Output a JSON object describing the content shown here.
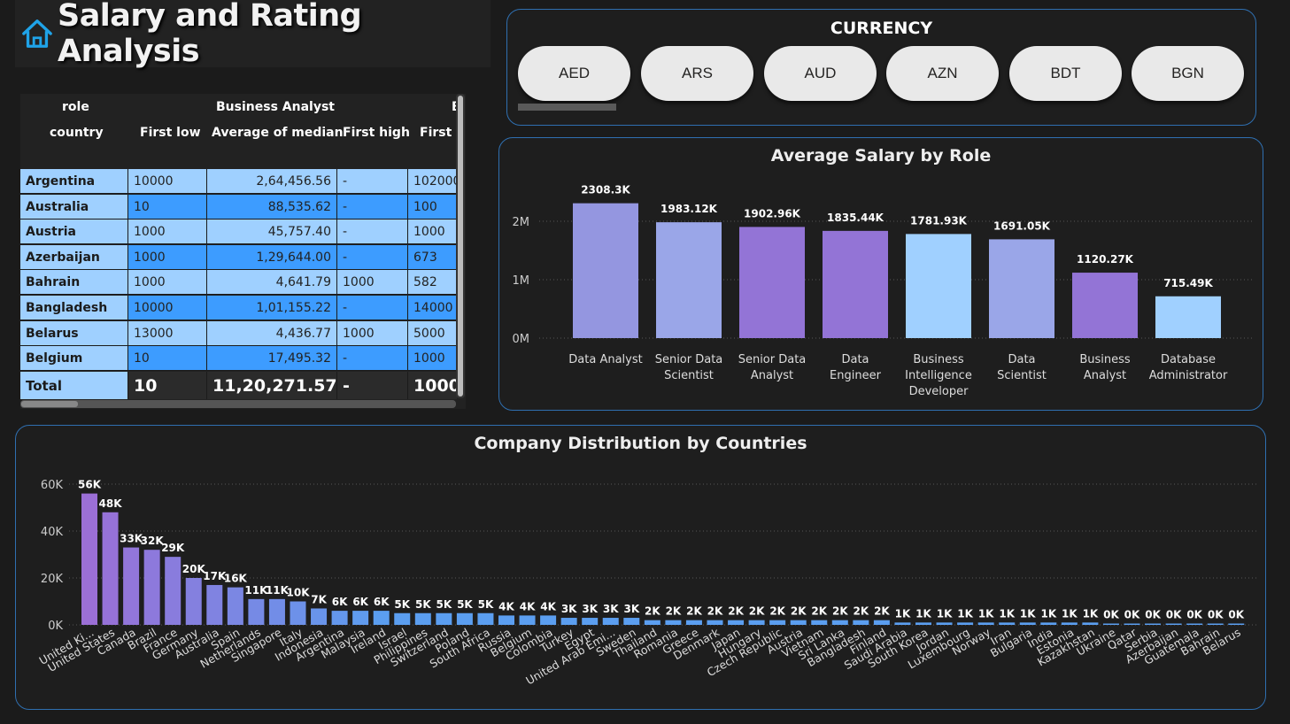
{
  "title": "Salary and Rating Analysis",
  "matrix": {
    "header_row1": {
      "role_label": "role",
      "group1": "Business Analyst",
      "group2_partial": "B"
    },
    "header_row2": {
      "country_label": "country",
      "col1": "First low",
      "col2": "Average of median",
      "col3": "First high",
      "col4_partial": "First lo"
    },
    "rows": [
      {
        "country": "Argentina",
        "first_low": "10000",
        "avg_median": "2,64,456.56",
        "first_high": "-",
        "next": "102000"
      },
      {
        "country": "Australia",
        "first_low": "10",
        "avg_median": "88,535.62",
        "first_high": "-",
        "next": "100"
      },
      {
        "country": "Austria",
        "first_low": "1000",
        "avg_median": "45,757.40",
        "first_high": "-",
        "next": "1000"
      },
      {
        "country": "Azerbaijan",
        "first_low": "1000",
        "avg_median": "1,29,644.00",
        "first_high": "-",
        "next": "673"
      },
      {
        "country": "Bahrain",
        "first_low": "1000",
        "avg_median": "4,641.79",
        "first_high": "1000",
        "next": "582"
      },
      {
        "country": "Bangladesh",
        "first_low": "10000",
        "avg_median": "1,01,155.22",
        "first_high": "-",
        "next": "14000"
      },
      {
        "country": "Belarus",
        "first_low": "13000",
        "avg_median": "4,436.77",
        "first_high": "1000",
        "next": "5000"
      },
      {
        "country": "Belgium",
        "first_low": "10",
        "avg_median": "17,495.32",
        "first_high": "-",
        "next": "1000"
      }
    ],
    "total": {
      "label": "Total",
      "first_low": "10",
      "avg_median": "11,20,271.57",
      "first_high": "-",
      "next": "1000"
    }
  },
  "currency": {
    "title": "CURRENCY",
    "options": [
      "AED",
      "ARS",
      "AUD",
      "AZN",
      "BDT",
      "BGN"
    ]
  },
  "colors": {
    "purple": "#9374d6",
    "lavender": "#9aa6e8",
    "light_blue": "#a0d0ff",
    "bar_blue": "#5b9ef0"
  },
  "chart_data": [
    {
      "type": "bar",
      "title": "Average Salary by Role",
      "categories": [
        "Data Analyst",
        "Senior Data Scientist",
        "Senior Data Analyst",
        "Data Engineer",
        "Business Intelligence Developer",
        "Data Scientist",
        "Business Analyst",
        "Database Administrator"
      ],
      "values": [
        2308.3,
        1983.12,
        1902.96,
        1835.44,
        1781.93,
        1691.05,
        1120.27,
        715.49
      ],
      "value_labels": [
        "2308.3K",
        "1983.12K",
        "1902.96K",
        "1835.44K",
        "1781.93K",
        "1691.05K",
        "1120.27K",
        "715.49K"
      ],
      "bar_colors": [
        "#9496e0",
        "#9aa6e8",
        "#9374d6",
        "#9374d6",
        "#a0d0ff",
        "#9aa6e8",
        "#9374d6",
        "#a0d0ff"
      ],
      "yticks": [
        "0M",
        "1M",
        "2M"
      ],
      "ylim": [
        0,
        2500
      ],
      "unit": "K",
      "grid": true
    },
    {
      "type": "bar",
      "title": "Company Distribution by Countries",
      "categories": [
        "United Ki...",
        "United States",
        "Canada",
        "Brazil",
        "France",
        "Germany",
        "Australia",
        "Spain",
        "Netherlands",
        "Singapore",
        "Italy",
        "Indonesia",
        "Argentina",
        "Malaysia",
        "Ireland",
        "Israel",
        "Philippines",
        "Switzerland",
        "Poland",
        "South Africa",
        "Russia",
        "Belgium",
        "Colombia",
        "Turkey",
        "Egypt",
        "United Arab Emi...",
        "Sweden",
        "Thailand",
        "Romania",
        "Greece",
        "Denmark",
        "Japan",
        "Hungary",
        "Czech Republic",
        "Austria",
        "Vietnam",
        "Sri Lanka",
        "Bangladesh",
        "Finland",
        "Saudi Arabia",
        "South Korea",
        "Jordan",
        "Luxembourg",
        "Norway",
        "Iran",
        "Bulgaria",
        "India",
        "Estonia",
        "Kazakhstan",
        "Ukraine",
        "Qatar",
        "Serbia",
        "Azerbaijan",
        "Guatemala",
        "Bahrain",
        "Belarus"
      ],
      "values": [
        56,
        48,
        33,
        32,
        29,
        20,
        17,
        16,
        11,
        11,
        10,
        7,
        6,
        6,
        6,
        5,
        5,
        5,
        5,
        5,
        4,
        4,
        4,
        3,
        3,
        3,
        3,
        2,
        2,
        2,
        2,
        2,
        2,
        2,
        2,
        2,
        2,
        2,
        2,
        1,
        1,
        1,
        1,
        1,
        1,
        1,
        1,
        1,
        1,
        0,
        0,
        0,
        0,
        0,
        0,
        0
      ],
      "value_labels": [
        "56K",
        "48K",
        "33K",
        "32K",
        "29K",
        "20K",
        "17K",
        "16K",
        "11K",
        "11K",
        "10K",
        "7K",
        "6K",
        "6K",
        "6K",
        "5K",
        "5K",
        "5K",
        "5K",
        "5K",
        "4K",
        "4K",
        "4K",
        "3K",
        "3K",
        "3K",
        "3K",
        "2K",
        "2K",
        "2K",
        "2K",
        "2K",
        "2K",
        "2K",
        "2K",
        "2K",
        "2K",
        "2K",
        "2K",
        "1K",
        "1K",
        "1K",
        "1K",
        "1K",
        "1K",
        "1K",
        "1K",
        "1K",
        "1K",
        "0K",
        "0K",
        "0K",
        "0K",
        "0K",
        "0K",
        "0K"
      ],
      "gradient": [
        "#9b6fd6",
        "#5b9ef0"
      ],
      "yticks": [
        "0K",
        "20K",
        "40K",
        "60K"
      ],
      "ylim": [
        0,
        60
      ],
      "unit": "K",
      "grid": true
    }
  ]
}
